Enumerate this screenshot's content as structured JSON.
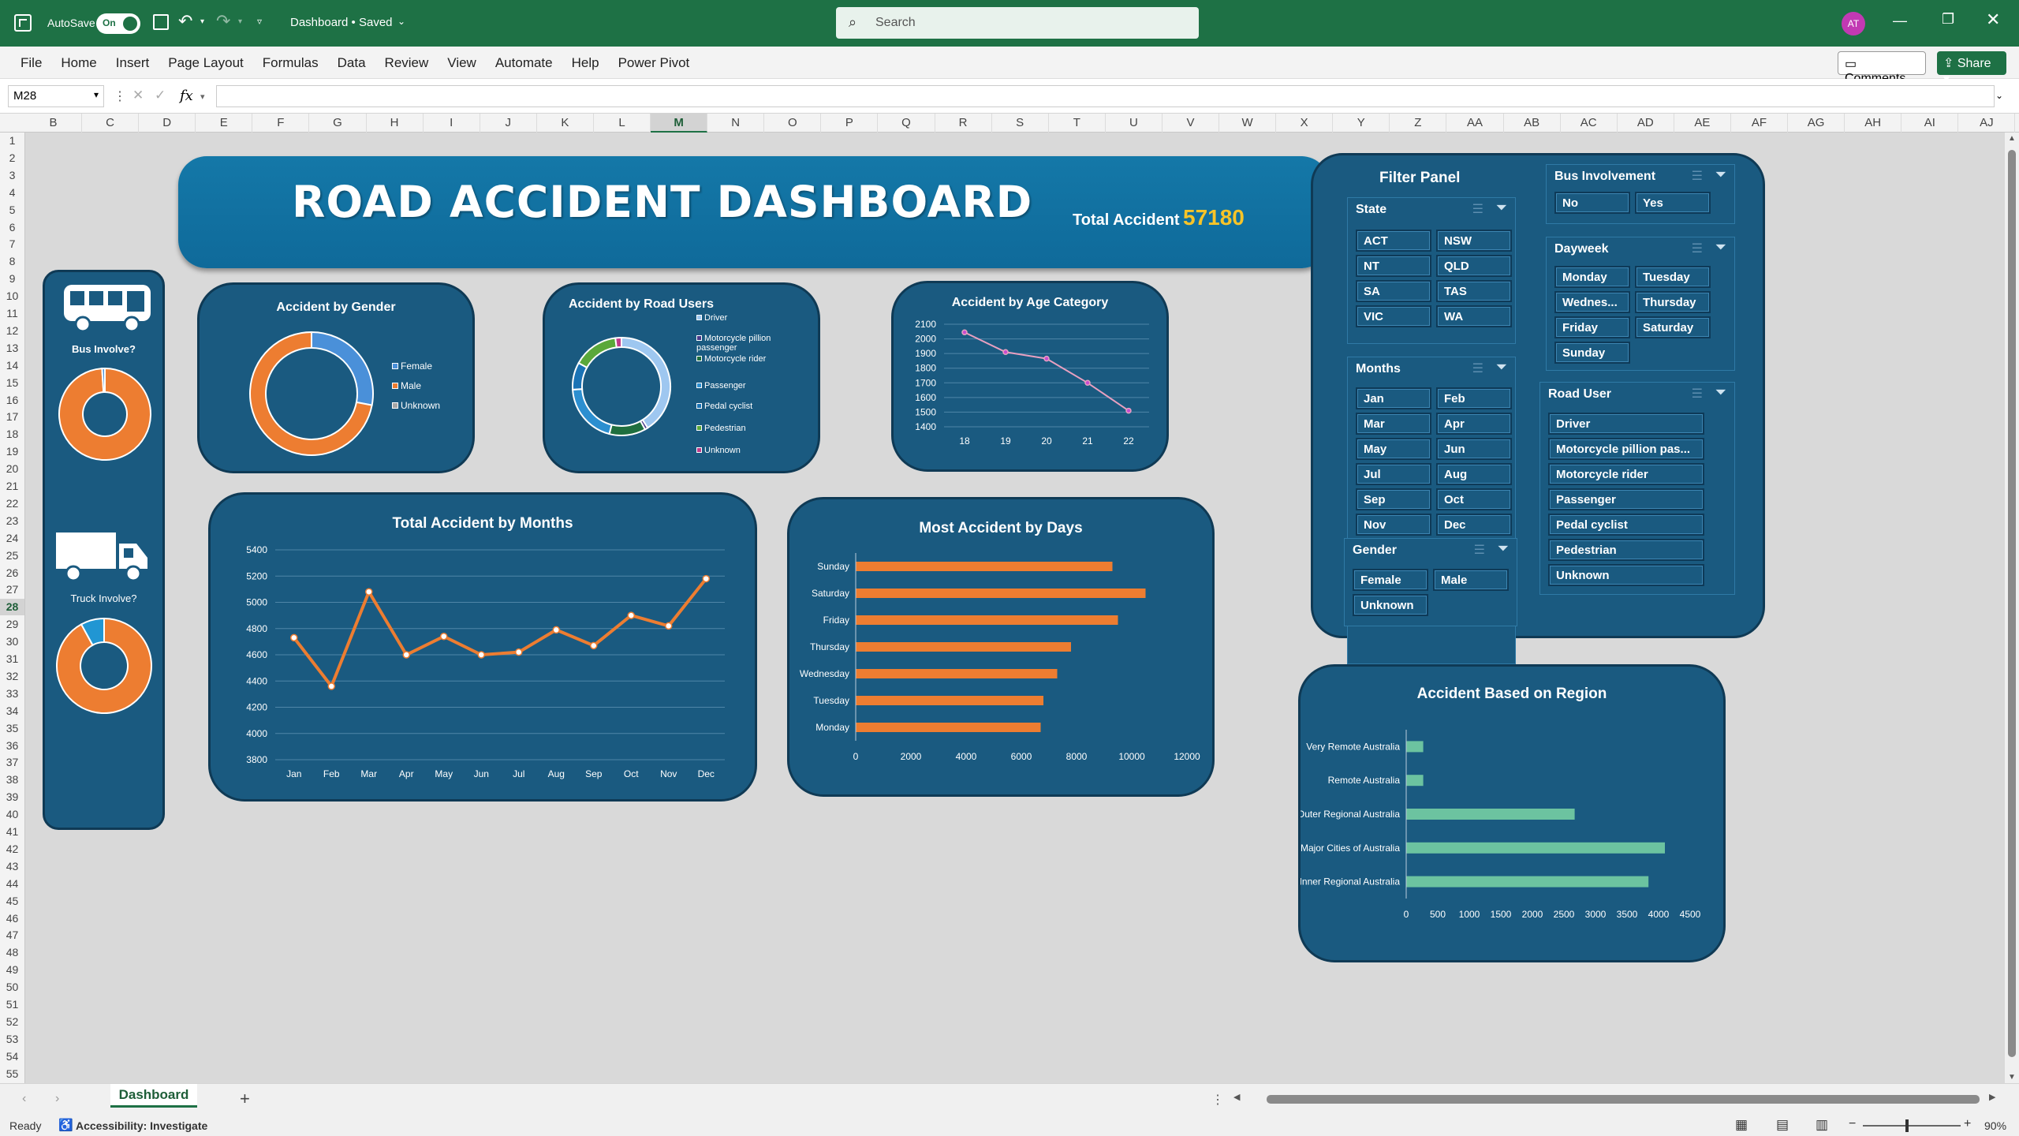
{
  "window": {
    "autosave_label": "AutoSave",
    "autosave_state": "On",
    "doc_title": "Dashboard • Saved",
    "search_placeholder": "Search",
    "avatar": "AT"
  },
  "ribbon": {
    "menu": [
      "File",
      "Home",
      "Insert",
      "Page Layout",
      "Formulas",
      "Data",
      "Review",
      "View",
      "Automate",
      "Help",
      "Power Pivot"
    ],
    "comments": "Comments",
    "share": "Share"
  },
  "formula": {
    "name_box": "M28",
    "fx": "fx",
    "value": ""
  },
  "columns": [
    "B",
    "C",
    "D",
    "E",
    "F",
    "G",
    "H",
    "I",
    "J",
    "K",
    "L",
    "M",
    "N",
    "O",
    "P",
    "Q",
    "R",
    "S",
    "T",
    "U",
    "V",
    "W",
    "X",
    "Y",
    "Z",
    "AA",
    "AB",
    "AC",
    "AD",
    "AE",
    "AF",
    "AG",
    "AH",
    "AI",
    "AJ"
  ],
  "rows": [
    "1",
    "2",
    "3",
    "4",
    "5",
    "6",
    "7",
    "8",
    "9",
    "10",
    "11",
    "12",
    "13",
    "14",
    "15",
    "16",
    "17",
    "18",
    "19",
    "20",
    "21",
    "22",
    "23",
    "24",
    "25",
    "26",
    "27",
    "28",
    "29",
    "30",
    "31",
    "32",
    "33",
    "34",
    "35",
    "36",
    "37",
    "38",
    "39",
    "40",
    "41",
    "42",
    "43",
    "44",
    "45",
    "46",
    "47",
    "48",
    "49",
    "50",
    "51",
    "52",
    "53",
    "54",
    "55"
  ],
  "selected_column": "M",
  "selected_row": "28",
  "header": {
    "title": "ROAD ACCIDENT DASHBOARD",
    "total_label": "Total Accident",
    "total_value": "57180"
  },
  "sidebar": {
    "bus_label": "Bus Involve?",
    "truck_label": "Truck Involve?"
  },
  "filter_panel": {
    "title": "Filter Panel",
    "state": {
      "title": "State",
      "items": [
        "ACT",
        "NSW",
        "NT",
        "QLD",
        "SA",
        "TAS",
        "VIC",
        "WA"
      ]
    },
    "months": {
      "title": "Months",
      "items": [
        "Jan",
        "Feb",
        "Mar",
        "Apr",
        "May",
        "Jun",
        "Jul",
        "Aug",
        "Sep",
        "Oct",
        "Nov",
        "Dec"
      ]
    },
    "gender": {
      "title": "Gender",
      "items": [
        "Female",
        "Male",
        "Unknown"
      ]
    },
    "bus": {
      "title": "Bus Involvement",
      "items": [
        "No",
        "Yes"
      ]
    },
    "dayweek": {
      "title": "Dayweek",
      "items": [
        "Monday",
        "Tuesday",
        "Wednes...",
        "Thursday",
        "Friday",
        "Saturday",
        "Sunday"
      ]
    },
    "road_user": {
      "title": "Road User",
      "items": [
        "Driver",
        "Motorcycle pillion pas...",
        "Motorcycle rider",
        "Passenger",
        "Pedal cyclist",
        "Pedestrian",
        "Unknown"
      ]
    }
  },
  "colors": {
    "panel": "#1a5a80",
    "orange": "#ed7d31",
    "blue": "#4a90d9",
    "green": "#6cc3a0",
    "pink": "#e8a0c0",
    "gold": "#f7c428"
  },
  "sheet_tabs": {
    "active": "Dashboard"
  },
  "status": {
    "ready": "Ready",
    "accessibility": "Accessibility: Investigate",
    "zoom": "90%"
  },
  "chart_data": [
    {
      "type": "pie",
      "title": "Accident by Gender",
      "categories": [
        "Female",
        "Male",
        "Unknown"
      ],
      "values": [
        28,
        72,
        0
      ],
      "colors": [
        "#4a90d9",
        "#ed7d31",
        "#a5a5a5"
      ]
    },
    {
      "type": "pie",
      "title": "Accident by Road Users",
      "categories": [
        "Driver",
        "Motorcycle pillion passenger",
        "Motorcycle rider",
        "Passenger",
        "Pedal cyclist",
        "Pedestrian",
        "Unknown"
      ],
      "values": [
        41,
        1,
        12,
        20,
        9,
        15,
        2
      ],
      "colors": [
        "#9ec7f0",
        "#4a3a8a",
        "#1f6f3f",
        "#2c8fd0",
        "#1a73b5",
        "#5aa83a",
        "#c03a8a"
      ]
    },
    {
      "type": "line",
      "title": "Accident by Age Category",
      "x": [
        "18",
        "19",
        "20",
        "21",
        "22"
      ],
      "values": [
        2045,
        1910,
        1865,
        1700,
        1510
      ],
      "ylim": [
        1400,
        2100
      ]
    },
    {
      "type": "line",
      "title": "Total Accident by Months",
      "x": [
        "Jan",
        "Feb",
        "Mar",
        "Apr",
        "May",
        "Jun",
        "Jul",
        "Aug",
        "Sep",
        "Oct",
        "Nov",
        "Dec"
      ],
      "values": [
        4730,
        4360,
        5080,
        4600,
        4740,
        4600,
        4620,
        4790,
        4670,
        4900,
        4820,
        5180
      ],
      "ylim": [
        3800,
        5400
      ]
    },
    {
      "type": "bar",
      "title": "Most Accident by Days",
      "categories": [
        "Sunday",
        "Saturday",
        "Friday",
        "Thursday",
        "Wednesday",
        "Tuesday",
        "Monday"
      ],
      "values": [
        9300,
        10500,
        9500,
        7800,
        7300,
        6800,
        6700
      ],
      "xlim": [
        0,
        12000
      ]
    },
    {
      "type": "bar",
      "title": "Accident Based on Region",
      "categories": [
        "Very Remote Australia",
        "Remote Australia",
        "Outer Regional Australia",
        "Major Cities of Australia",
        "Inner Regional Australia"
      ],
      "values": [
        270,
        270,
        2670,
        4100,
        3840
      ],
      "xlim": [
        0,
        4500
      ]
    },
    {
      "type": "pie",
      "title": "Bus Involve?",
      "categories": [
        "No",
        "Yes"
      ],
      "values": [
        99,
        1
      ],
      "colors": [
        "#ed7d31",
        "#4a90d9"
      ]
    },
    {
      "type": "pie",
      "title": "Truck Involve?",
      "categories": [
        "No",
        "Yes"
      ],
      "values": [
        92,
        8
      ],
      "colors": [
        "#ed7d31",
        "#2196d3"
      ]
    }
  ]
}
